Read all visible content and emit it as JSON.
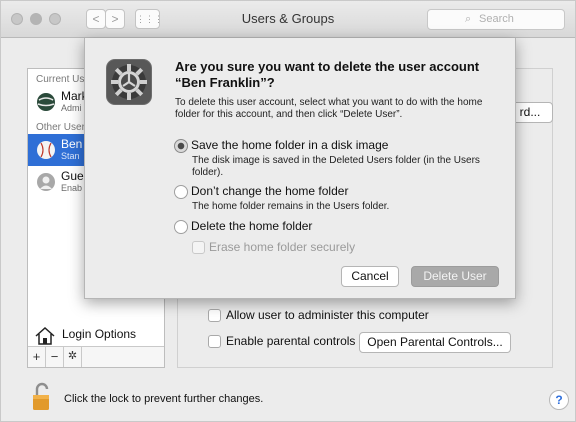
{
  "window": {
    "title": "Users & Groups",
    "search_placeholder": "Search",
    "search_icon": "magnifier-icon",
    "nav": {
      "back": "<",
      "forward": ">",
      "grid": "⋮⋮⋮"
    }
  },
  "sidebar": {
    "current_users_label": "Current Us",
    "other_users_label": "Other User",
    "users": [
      {
        "name": "Mark",
        "role": "Admi",
        "avatar": "globe-avatar",
        "selected": false
      },
      {
        "name": "Ben",
        "role": "Stan",
        "avatar": "baseball-avatar",
        "selected": true
      },
      {
        "name": "Gue",
        "role": "Enab",
        "avatar": "guest-avatar",
        "selected": false
      }
    ],
    "login_options": "Login Options",
    "tools": {
      "add": "+",
      "remove": "−",
      "action": "✲"
    }
  },
  "content": {
    "password_button_fragment": "rd...",
    "allow_admin": "Allow user to administer this computer",
    "parental_controls": "Enable parental controls",
    "open_parental_button": "Open Parental Controls..."
  },
  "sheet": {
    "title": "Are you sure you want to delete the user account “Ben Franklin”?",
    "description": "To delete this user account, select what you want to do with the home folder for this account, and then click “Delete User”.",
    "options": [
      {
        "label": "Save the home folder in a disk image",
        "sub": "The disk image is saved in the Deleted Users folder (in the Users folder).",
        "selected": true
      },
      {
        "label": "Don’t change the home folder",
        "sub": "The home folder remains in the Users folder.",
        "selected": false
      },
      {
        "label": "Delete the home folder",
        "sub": "",
        "selected": false
      }
    ],
    "erase_label": "Erase home folder securely",
    "cancel": "Cancel",
    "delete": "Delete User"
  },
  "footer": {
    "lock_text": "Click the lock to prevent further changes.",
    "help": "?"
  },
  "colors": {
    "selection": "#2f6fd6",
    "window_bg": "#ececec"
  }
}
